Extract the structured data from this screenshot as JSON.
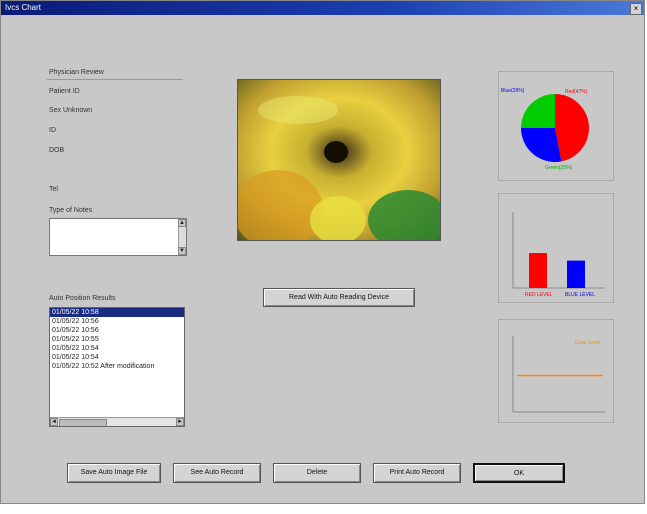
{
  "window": {
    "title": "Ivcs Chart",
    "close": "×"
  },
  "patient": {
    "header": "Physician Review",
    "fields": [
      "Patient ID",
      "Sex    Unknown",
      "ID",
      "DOB",
      "Tel"
    ],
    "notes_label": "Type of Notes",
    "notes_value": ""
  },
  "images": {
    "label": "Auto Position Results",
    "items": [
      "01/05/22  10:58",
      "01/05/22  10:56",
      "01/05/22  10:56",
      "01/05/22  10:55",
      "01/05/22  10:54",
      "01/05/22  10:54",
      "01/05/22  10:52  After modification"
    ],
    "selected_index": 0
  },
  "center": {
    "read_button": "Read With Auto Reading Device"
  },
  "charts": {
    "pie": {
      "legend": "",
      "label_red": "Red(47%)",
      "label_blue": "Blue(28%)",
      "label_green": "Green(25%)"
    },
    "bar": {
      "title": "",
      "label_red": "RED LEVEL",
      "label_blue": "BLUE LEVEL"
    },
    "line": {
      "title": "",
      "legend": "Color Level"
    }
  },
  "chart_data": [
    {
      "type": "pie",
      "categories": [
        "Red",
        "Blue",
        "Green"
      ],
      "values": [
        47,
        28,
        25
      ],
      "colors": [
        "#ff0000",
        "#0000ff",
        "#00cc00"
      ]
    },
    {
      "type": "bar",
      "categories": [
        "RED LEVEL",
        "BLUE LEVEL"
      ],
      "values": [
        46,
        36
      ],
      "ylim": [
        0,
        100
      ],
      "colors": [
        "#ff0000",
        "#0000ff"
      ]
    },
    {
      "type": "line",
      "series": [
        {
          "name": "Color Level",
          "values": [
            48,
            48,
            48,
            48,
            48,
            48,
            48,
            48
          ]
        }
      ],
      "ylim": [
        0,
        100
      ],
      "color": "#ff8800"
    }
  ],
  "buttons": {
    "save": "Save Auto Image File",
    "see": "See Auto Record",
    "delete": "Delete",
    "print": "Print Auto Record",
    "ok": "OK"
  }
}
